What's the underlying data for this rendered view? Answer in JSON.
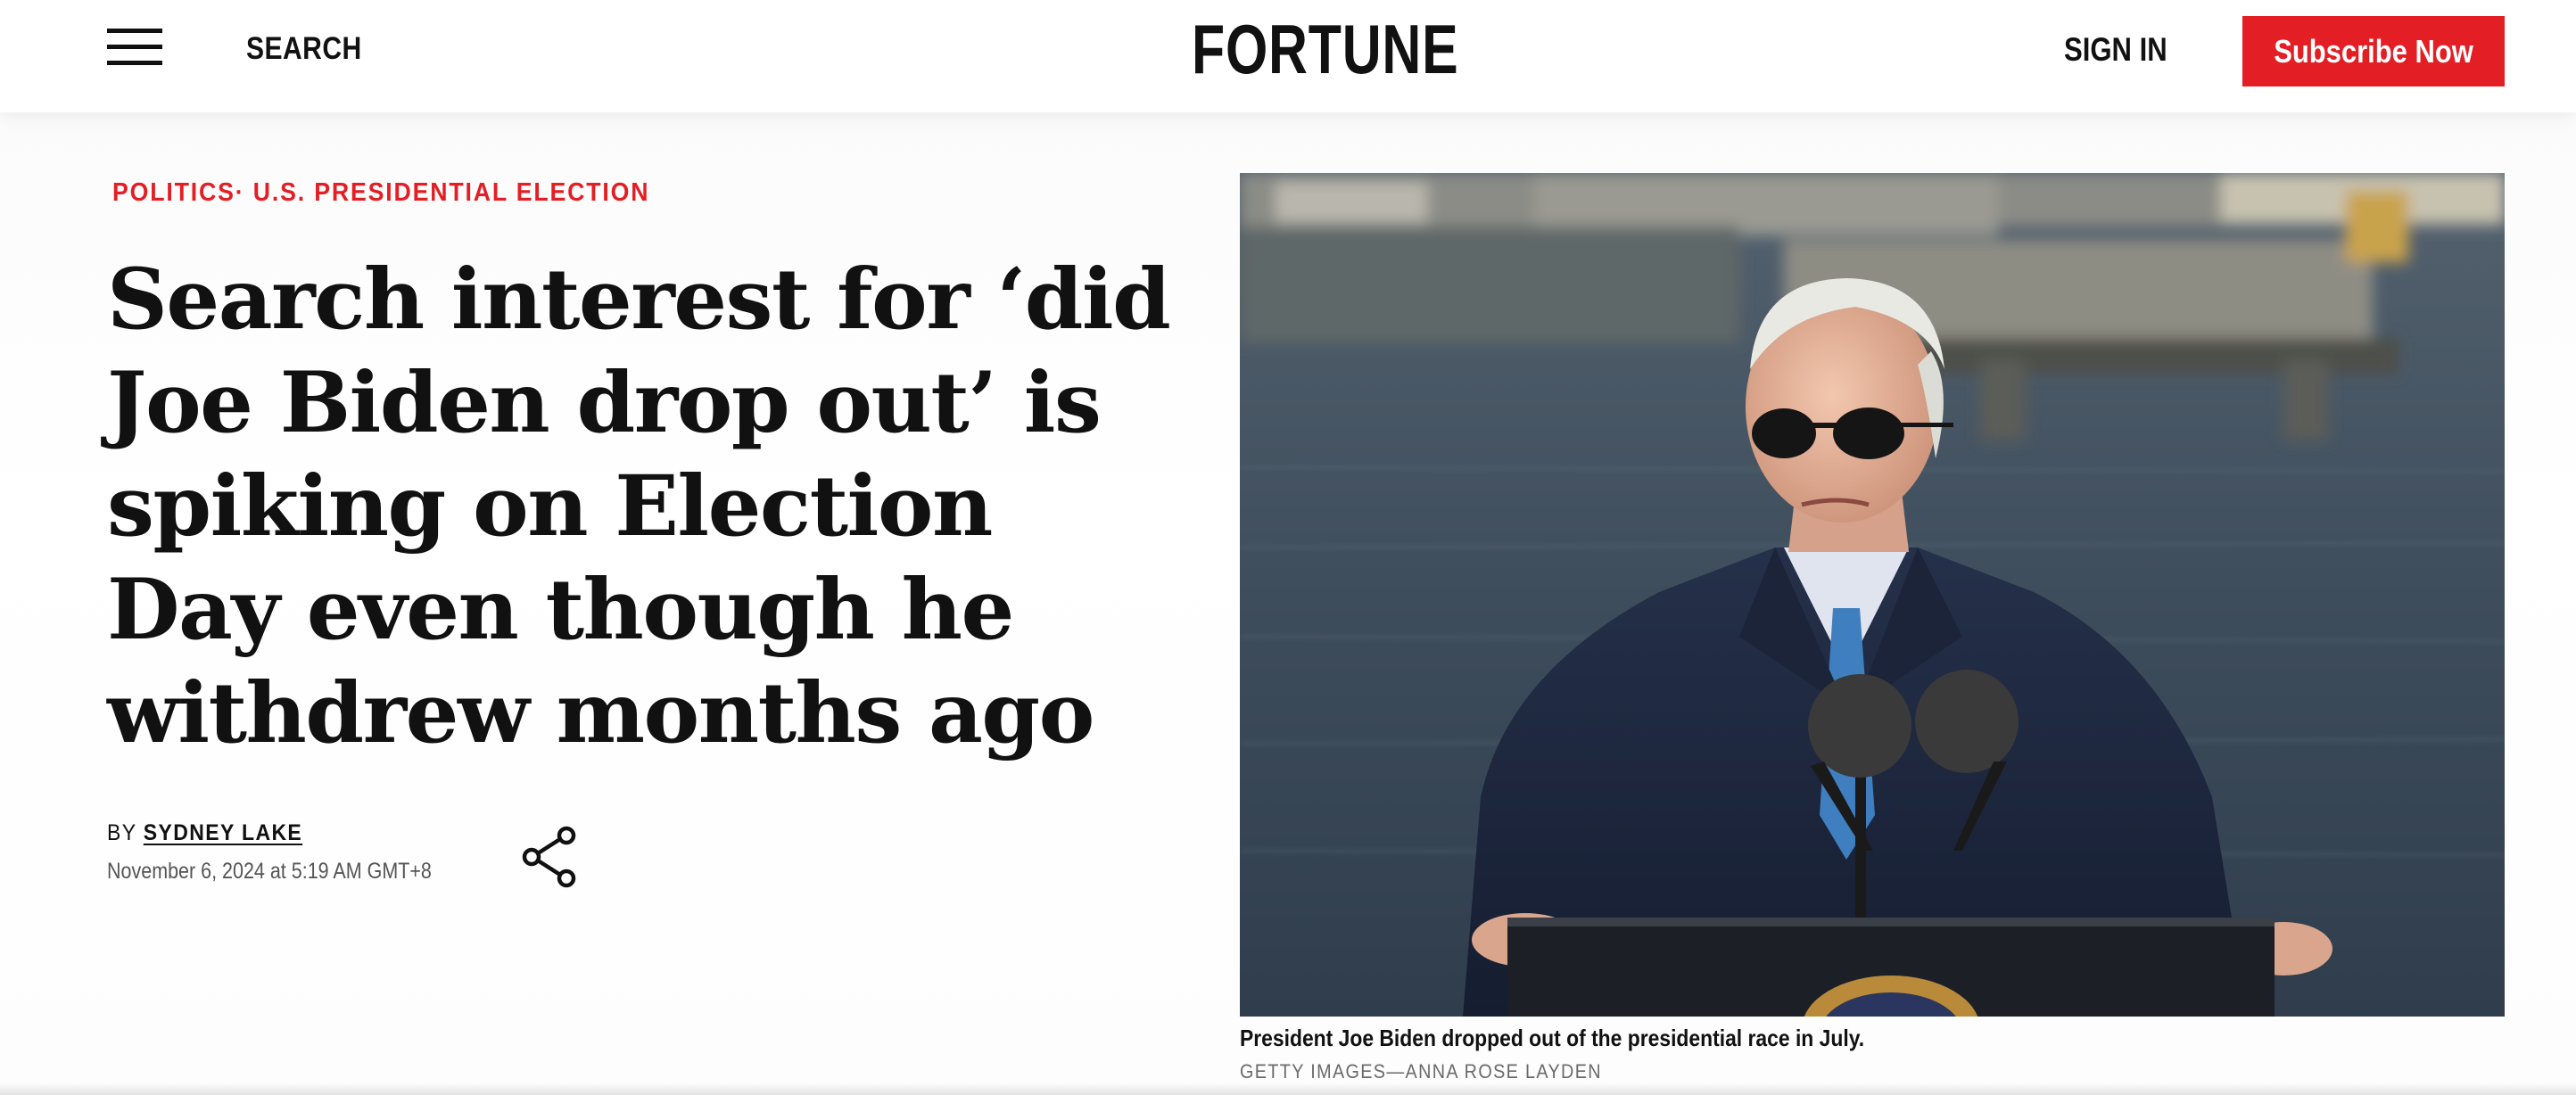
{
  "header": {
    "menu_icon": "hamburger-menu-icon",
    "search_label": "SEARCH",
    "logo_text": "FORTUNE",
    "signin_label": "SIGN IN",
    "subscribe_label": "Subscribe Now",
    "brand_color": "#e31e24"
  },
  "article": {
    "breadcrumb": {
      "section": "POLITICS",
      "separator": "·",
      "topic": "U.S. PRESIDENTIAL ELECTION"
    },
    "headline": "Search interest for ‘did Joe Biden drop out’ is spiking on Election Day even though he withdrew months ago",
    "byline_prefix": "BY",
    "author": "SYDNEY LAKE",
    "date": "November 6, 2024 at 5:19 AM GMT+8",
    "share_icon": "share-icon"
  },
  "hero": {
    "caption": "President Joe Biden dropped out of the presidential race in July.",
    "credit": "GETTY IMAGES—ANNA ROSE LAYDEN"
  }
}
